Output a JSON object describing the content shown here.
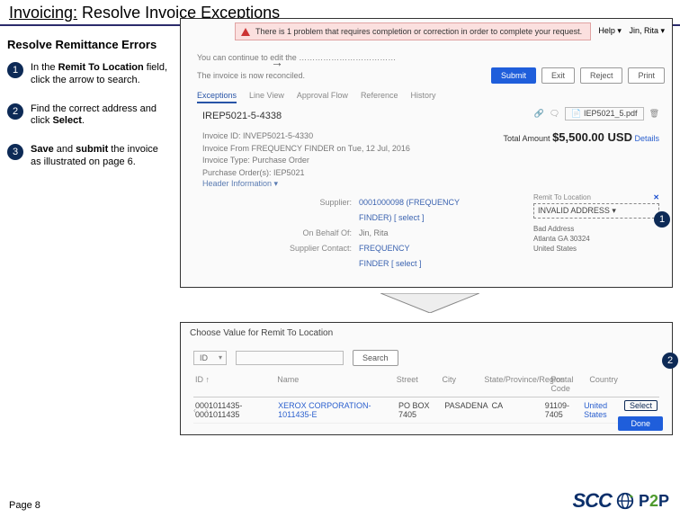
{
  "title_under": "Invoicing:",
  "title_rest": " Resolve Invoice Exceptions",
  "subtitle": "Resolve Remittance Errors",
  "steps": [
    {
      "num": "1",
      "html": "In the <b>Remit To Location</b> field, click the arrow to search."
    },
    {
      "num": "2",
      "html": "Find the correct address and click <b>Select</b>."
    },
    {
      "num": "3",
      "html": "<b>Save</b> and <b>submit</b> the invoice as illustrated on page 6."
    }
  ],
  "shot1": {
    "alert": "There is 1 problem that requires completion or correction in order to complete your request.",
    "help": "Help ▾",
    "user": "Jin, Rita ▾",
    "cont": "You can continue to edit the ………………………………",
    "recon": "The invoice is now reconciled.",
    "buttons": {
      "submit": "Submit",
      "exit": "Exit",
      "reject": "Reject",
      "print": "Print"
    },
    "tabs": [
      "Exceptions",
      "Line View",
      "Approval Flow",
      "Reference",
      "History"
    ],
    "irep": "IREP5021-5-4338",
    "filechip": "IEP5021_5.pdf",
    "meta": {
      "l1": "Invoice ID: INVEP5021-5-4330",
      "l2": "Invoice From  FREQUENCY FINDER  on  Tue, 12 Jul, 2016",
      "l3": "Invoice Type: Purchase Order",
      "l4": "Purchase Order(s): IEP5021"
    },
    "total_lbl": "Total Amount",
    "total_amt": "$5,500.00 USD",
    "total_det": "Details",
    "header_info": "Header Information ▾",
    "fields": {
      "supplier_lbl": "Supplier:",
      "supplier_val": "0001000098 (FREQUENCY",
      "supplier_val2": "FINDER) [ select ]",
      "behalf_lbl": "On Behalf Of:",
      "behalf_val": "Jin, Rita",
      "contact_lbl": "Supplier Contact:",
      "contact_val": "FREQUENCY",
      "contact_val2": "FINDER [ select ]"
    },
    "remit": {
      "hdr": "Remit To Location",
      "inv": "INVALID ADDRESS ▾",
      "a1": "Bad Address",
      "a2": "Atlanta GA 30324",
      "a3": "United States"
    },
    "callout": "1"
  },
  "shot2": {
    "title": "Choose Value for Remit To Location",
    "id_lbl": "ID",
    "search": "Search",
    "head": {
      "id": "ID ↑",
      "name": "Name",
      "street": "Street",
      "city": "City",
      "state": "State/Province/Region",
      "zip": "Postal Code",
      "country": "Country"
    },
    "row": {
      "id": "0001011435-0001011435",
      "name": "XEROX CORPORATION-1011435-E",
      "street": "PO BOX 7405",
      "city": "PASADENA",
      "state": "CA",
      "zip": "91109-7405",
      "country": "United States",
      "select": "Select"
    },
    "done": "Done",
    "callout": "2"
  },
  "page": "Page 8",
  "logo": {
    "scc": "SCC",
    "p1": "P",
    "two": "2",
    "p2": "P"
  }
}
